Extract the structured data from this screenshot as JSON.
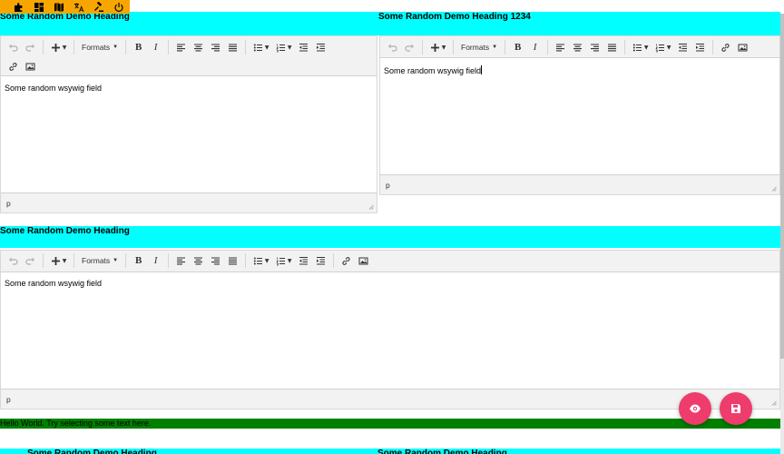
{
  "colors": {
    "heading_bg": "#00ffff",
    "admin_bar": "#f7a600",
    "fab": "#ee3c6d",
    "hello_bg": "#008000"
  },
  "admin_bar": {
    "icons": [
      "puzzle-icon",
      "dashboard-icon",
      "map-icon",
      "translate-icon",
      "gavel-icon",
      "power-icon"
    ]
  },
  "headings": {
    "left": "Some Random Demo Heading",
    "right": "Some Random Demo Heading 1234",
    "second": "Some Random Demo Heading",
    "bottom_left": "Some Random Demo Heading",
    "bottom_right": "Some Random Demo Heading"
  },
  "toolbar": {
    "formats_label": "Formats",
    "bold": "B",
    "italic": "I"
  },
  "editors": {
    "left": {
      "text": "Some random wsywig field",
      "status": "p"
    },
    "right": {
      "text": "Some random wsywig field",
      "status": "p"
    },
    "second": {
      "text": "Some random wsywig field",
      "status": "p"
    }
  },
  "hello": {
    "text": "Hello World. Try selecting some text here."
  },
  "fabs": {
    "preview_icon": "eye-icon",
    "save_icon": "save-icon"
  }
}
